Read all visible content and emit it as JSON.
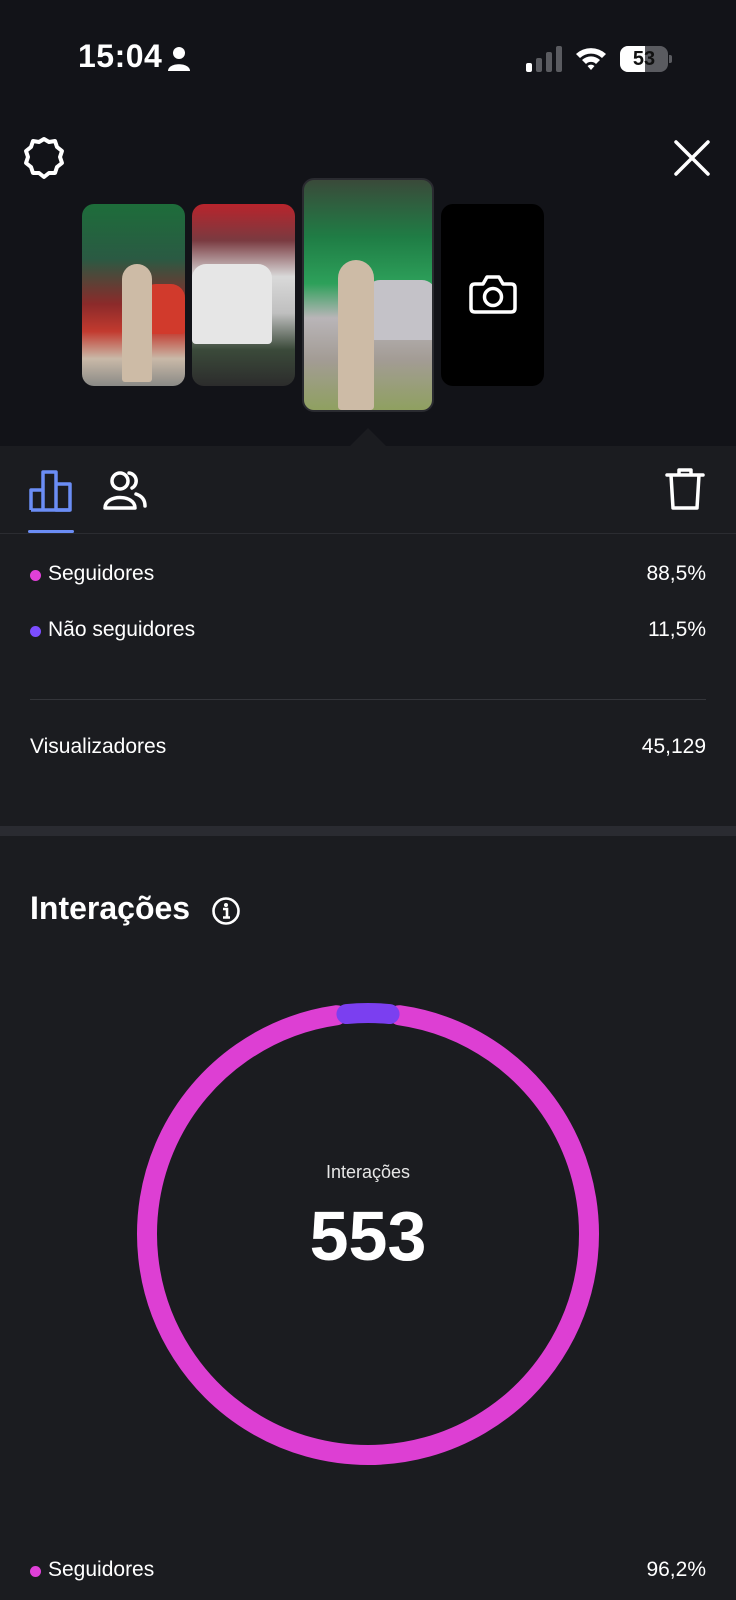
{
  "status_bar": {
    "time": "15:04",
    "battery": "53",
    "battery_level_percent": 53
  },
  "icons": {
    "person": "person-icon",
    "signal": "cellular-signal-icon",
    "wifi": "wifi-icon",
    "settings": "settings-gear-icon",
    "close": "close-icon",
    "camera": "camera-icon",
    "insights": "bar-chart-icon",
    "audience": "people-icon",
    "delete": "trash-icon",
    "info": "info-icon"
  },
  "thumbnails": [
    {
      "caption": ""
    },
    {
      "caption": ""
    },
    {
      "caption": ""
    }
  ],
  "breakdown": {
    "rows": [
      {
        "label": "Seguidores",
        "value": "88,5%",
        "color": "#e040d8"
      },
      {
        "label": "Não seguidores",
        "value": "11,5%",
        "color": "#7c4dff"
      }
    ],
    "viewers_label": "Visualizadores",
    "viewers_value": "45,129"
  },
  "interactions": {
    "title": "Interações",
    "center_label": "Interações",
    "center_value": "553",
    "followers_label": "Seguidores",
    "followers_value": "96,2%",
    "followers_color": "#e040d8"
  },
  "chart_data": {
    "type": "pie",
    "title": "Interações",
    "categories": [
      "Seguidores",
      "Não seguidores"
    ],
    "values": [
      96.2,
      3.8
    ],
    "colors": [
      "#dd3fd3",
      "#7b3ff0"
    ]
  },
  "colors": {
    "accent": "#6b8df5",
    "background": "#1b1c20",
    "followers": "#dd3fd3",
    "non_followers": "#7b3ff0"
  }
}
